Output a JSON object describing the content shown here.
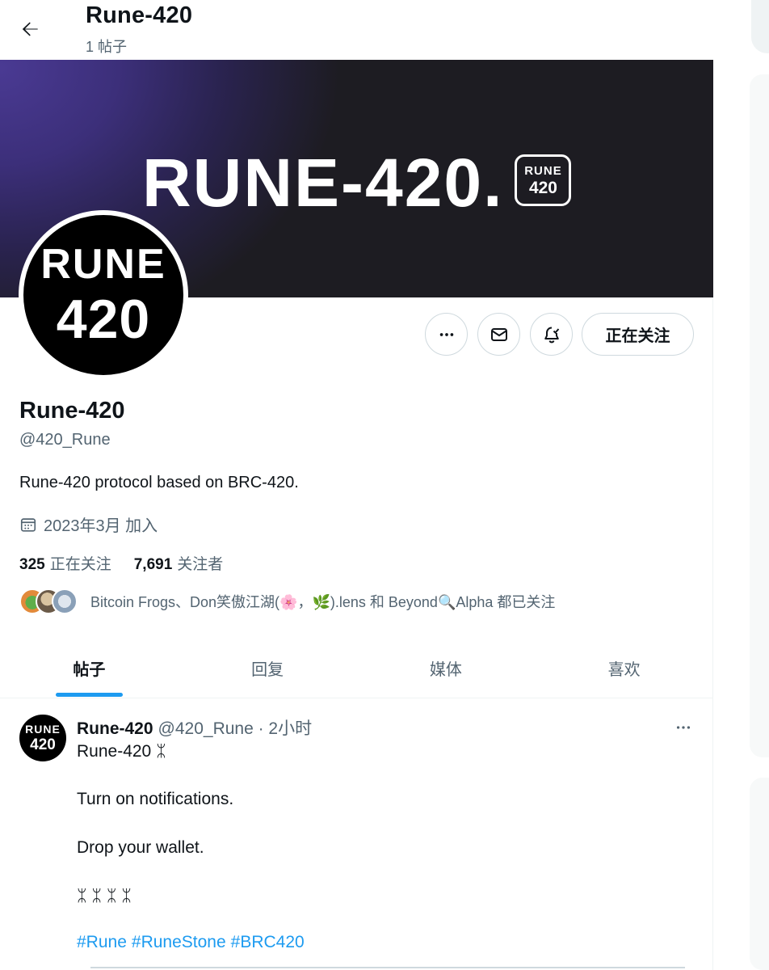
{
  "header": {
    "title": "Rune-420",
    "post_count": "1 帖子"
  },
  "banner": {
    "text": "RUNE-420.",
    "badge_top": "RUNE",
    "badge_bottom": "420"
  },
  "avatar": {
    "line1": "RUNE",
    "line2": "420"
  },
  "actions": {
    "follow_label": "正在关注",
    "more_icon": "more-icon",
    "message_icon": "envelope-icon",
    "notify_icon": "bell-icon"
  },
  "profile": {
    "name": "Rune-420",
    "handle": "@420_Rune",
    "bio": "Rune-420 protocol based on BRC-420.",
    "joined": "2023年3月 加入",
    "following_count": "325",
    "following_label": "正在关注",
    "followers_count": "7,691",
    "followers_label": "关注者",
    "known_followers": "Bitcoin Frogs、Don笑傲江湖(🌸，🌿).lens 和 Beyond🔍Alpha 都已关注"
  },
  "tabs": [
    {
      "label": "帖子",
      "active": true
    },
    {
      "label": "回复",
      "active": false
    },
    {
      "label": "媒体",
      "active": false
    },
    {
      "label": "喜欢",
      "active": false
    }
  ],
  "post": {
    "avatar_line1": "RUNE",
    "avatar_line2": "420",
    "author": "Rune-420",
    "handle_time": "@420_Rune · 2小时",
    "lines": [
      "Rune-420 ᛯ",
      "Turn on notifications.",
      "Drop your wallet.",
      "ᛯ ᛯ ᛯ ᛯ"
    ],
    "hashtags": [
      "#Rune",
      "#RuneStone",
      "#BRC420"
    ]
  },
  "colors": {
    "accent": "#1d9bf0",
    "muted": "#536471",
    "border": "#cfd9de"
  }
}
